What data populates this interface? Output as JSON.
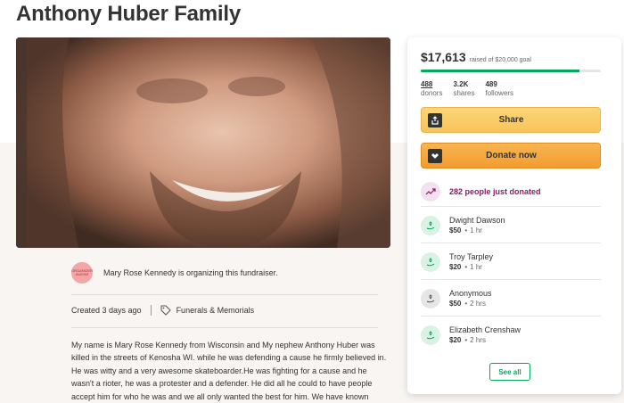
{
  "page": {
    "title": "Anthony Huber Family"
  },
  "organizer": {
    "avatar_text": "ORGANIZER AVATAR",
    "text": "Mary Rose Kennedy is organizing this fundraiser."
  },
  "meta": {
    "created": "Created 3 days ago",
    "category": "Funerals & Memorials"
  },
  "story": {
    "text": "My name is Mary Rose Kennedy from Wisconsin and My nephew Anthony Huber was killed in the streets of Kenosha WI.  while he was defending a cause he firmly believed in. He was witty and a very awesome skateboarder.He was fighting for a cause and he wasn't a rioter, he was a protester and a defender. He did all he could to have people accept him for who he was and we all only wanted the best for him.  We have known"
  },
  "donation_card": {
    "raised": "$17,613",
    "goal": "raised of $20,000 goal",
    "progress_fraction": 0.88,
    "stats": [
      {
        "num": "488",
        "label": "donors"
      },
      {
        "num": "3.2K",
        "label": "shares"
      },
      {
        "num": "489",
        "label": "followers"
      }
    ],
    "share_label": "Share",
    "donate_label": "Donate now",
    "recent_text": "282 people just donated",
    "donors": [
      {
        "name": "Dwight Dawson",
        "amount": "$50",
        "time": "1 hr",
        "icon": "green"
      },
      {
        "name": "Troy Tarpley",
        "amount": "$20",
        "time": "1 hr",
        "icon": "green"
      },
      {
        "name": "Anonymous",
        "amount": "$50",
        "time": "2 hrs",
        "icon": "grey"
      },
      {
        "name": "Elizabeth Crenshaw",
        "amount": "$20",
        "time": "2 hrs",
        "icon": "green"
      }
    ],
    "see_all_label": "See all",
    "colors": {
      "progress": "#02a95c",
      "share": "#f9c35c",
      "donate": "#f39c2e",
      "recent": "#8a1a6b"
    }
  }
}
